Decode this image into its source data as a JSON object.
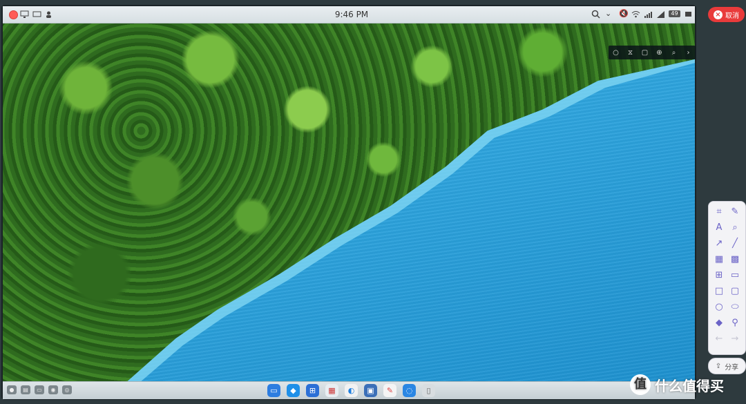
{
  "menubar": {
    "time": "9:46 PM",
    "battery": "49"
  },
  "annotation": {
    "cancel_label": "取消",
    "share_label": "分享",
    "tools": [
      {
        "name": "crop-tool",
        "glyph": "⌗"
      },
      {
        "name": "brush-tool",
        "glyph": "✎"
      },
      {
        "name": "text-tool",
        "glyph": "A"
      },
      {
        "name": "magnifier-tool",
        "glyph": "⌕"
      },
      {
        "name": "arrow-tool",
        "glyph": "↗"
      },
      {
        "name": "line-tool",
        "glyph": "╱"
      },
      {
        "name": "mosaic-tool",
        "glyph": "▦"
      },
      {
        "name": "blur-tool",
        "glyph": "▩"
      },
      {
        "name": "grid-tool",
        "glyph": "⊞"
      },
      {
        "name": "rect-outline-tool",
        "glyph": "▭"
      },
      {
        "name": "square-tool",
        "glyph": "□"
      },
      {
        "name": "rounded-rect-tool",
        "glyph": "▢"
      },
      {
        "name": "circle-tool",
        "glyph": "○"
      },
      {
        "name": "ellipse-tool",
        "glyph": "⬭"
      },
      {
        "name": "tag-tool",
        "glyph": "◆"
      },
      {
        "name": "pin-tool",
        "glyph": "⚲"
      },
      {
        "name": "undo-button",
        "glyph": "←"
      },
      {
        "name": "redo-button",
        "glyph": "→"
      }
    ]
  },
  "watermark": {
    "logo": "值",
    "text": "什么值得买"
  },
  "colors": {
    "accent": "#6b63c7",
    "cancel": "#e93b3b"
  }
}
